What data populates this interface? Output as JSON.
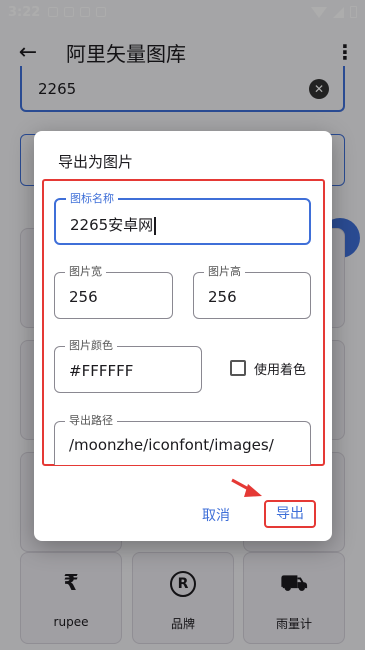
{
  "status_bar": {
    "time": "3:22"
  },
  "app_bar": {
    "back_icon": "arrow-left-icon",
    "title": "阿里矢量图库",
    "more_icon": "more-vert-icon"
  },
  "search": {
    "value": "2265"
  },
  "grid": [
    {
      "glyph": "₹",
      "label": "rupee"
    },
    {
      "glyph": "R",
      "label": "品牌"
    },
    {
      "glyph": "⛟",
      "label": "雨量计"
    }
  ],
  "dialog": {
    "title": "导出为图片",
    "icon_name": {
      "label": "图标名称",
      "value": "2265安卓网"
    },
    "width": {
      "label": "图片宽",
      "value": "256"
    },
    "height": {
      "label": "图片高",
      "value": "256"
    },
    "color": {
      "label": "图片颜色",
      "value": "#FFFFFF"
    },
    "use_tint": {
      "label": "使用着色",
      "checked": false
    },
    "path": {
      "label": "导出路径",
      "value": "/moonzhe/iconfont/images/"
    },
    "cancel": "取消",
    "export": "导出"
  },
  "colors": {
    "accent": "#3f6fd8",
    "highlight": "#e53935"
  }
}
